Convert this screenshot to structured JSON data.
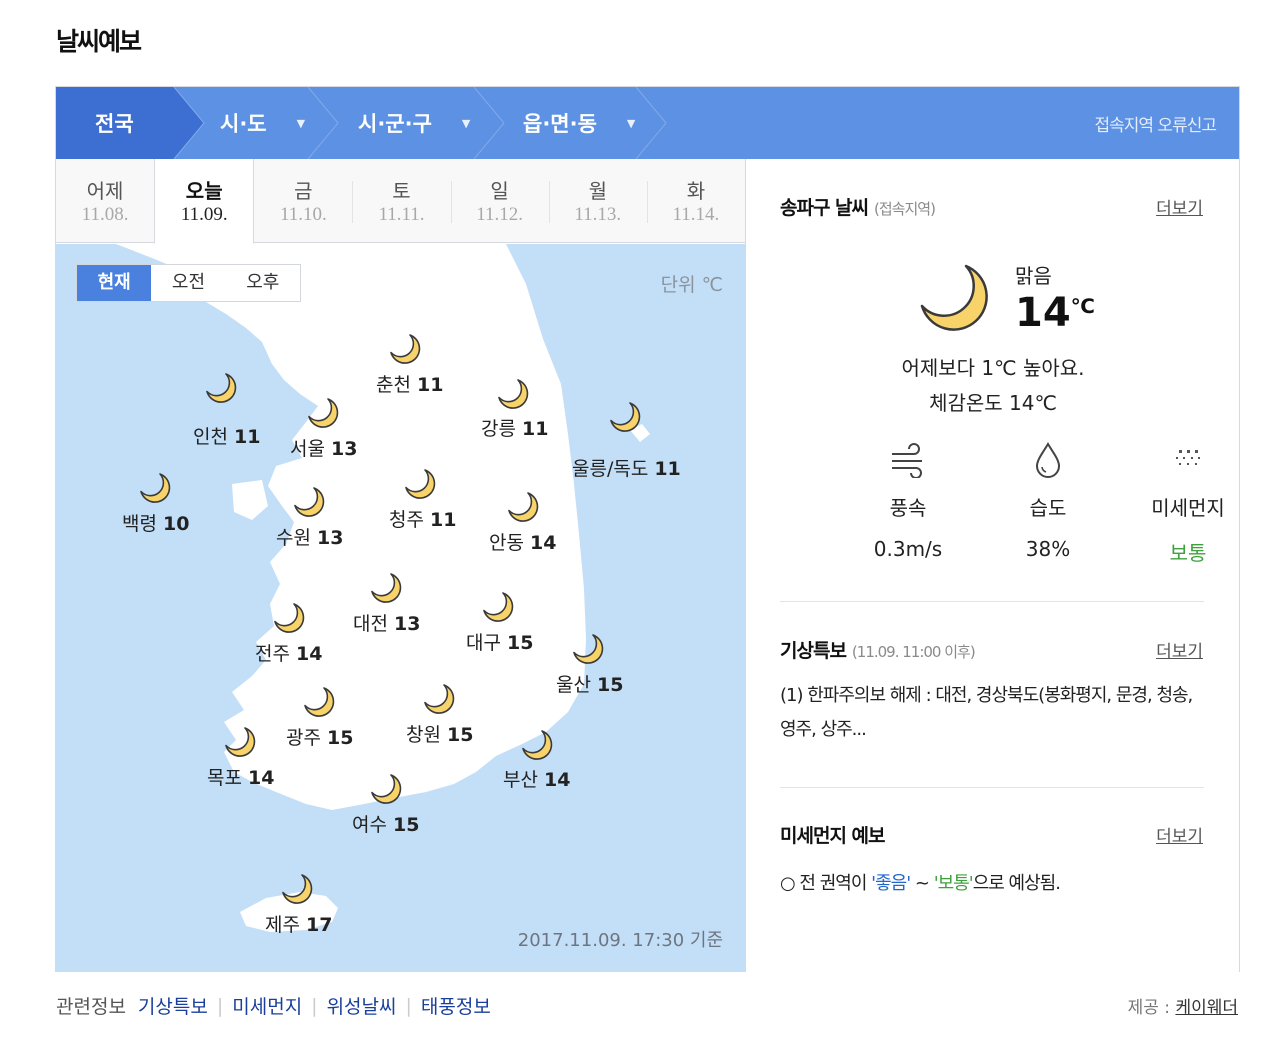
{
  "title": "날씨예보",
  "nav": {
    "tabs": [
      "전국",
      "시·도",
      "시·군·구",
      "읍·면·동"
    ],
    "report": "접속지역 오류신고"
  },
  "days": [
    {
      "name": "어제",
      "date": "11.08."
    },
    {
      "name": "오늘",
      "date": "11.09.",
      "selected": true
    },
    {
      "name": "금",
      "date": "11.10."
    },
    {
      "name": "토",
      "date": "11.11."
    },
    {
      "name": "일",
      "date": "11.12."
    },
    {
      "name": "월",
      "date": "11.13."
    },
    {
      "name": "화",
      "date": "11.14."
    }
  ],
  "map": {
    "time_tabs": [
      "현재",
      "오전",
      "오후"
    ],
    "unit": "단위 ℃",
    "basis": "2017.11.09. 17:30 기준",
    "colors": {
      "sea": "#c3def7",
      "land": "#ffffff",
      "moon": "#f7d36a",
      "moon_stroke": "#3a3a3a"
    },
    "icon": "crescent-moon-icon",
    "cities": [
      {
        "name": "춘천",
        "temp": "11"
      },
      {
        "name": "인천",
        "temp": "11"
      },
      {
        "name": "서울",
        "temp": "13"
      },
      {
        "name": "강릉",
        "temp": "11"
      },
      {
        "name": "울릉/독도",
        "temp": "11"
      },
      {
        "name": "백령",
        "temp": "10"
      },
      {
        "name": "수원",
        "temp": "13"
      },
      {
        "name": "청주",
        "temp": "11"
      },
      {
        "name": "안동",
        "temp": "14"
      },
      {
        "name": "대전",
        "temp": "13"
      },
      {
        "name": "대구",
        "temp": "15"
      },
      {
        "name": "전주",
        "temp": "14"
      },
      {
        "name": "울산",
        "temp": "15"
      },
      {
        "name": "광주",
        "temp": "15"
      },
      {
        "name": "창원",
        "temp": "15"
      },
      {
        "name": "목포",
        "temp": "14"
      },
      {
        "name": "부산",
        "temp": "14"
      },
      {
        "name": "여수",
        "temp": "15"
      },
      {
        "name": "제주",
        "temp": "17"
      }
    ]
  },
  "local": {
    "title": "송파구 날씨",
    "sub": "(접속지역)",
    "more": "더보기",
    "condition": "맑음",
    "temp": "14",
    "temp_unit": "℃",
    "compare": "어제보다 1℃ 높아요.",
    "feels": "체감온도 14℃",
    "stats": [
      {
        "label": "풍속",
        "value": "0.3m/s",
        "icon": "wind-icon"
      },
      {
        "label": "습도",
        "value": "38%",
        "icon": "droplet-icon"
      },
      {
        "label": "미세먼지",
        "value": "보통",
        "icon": "dust-icon",
        "color": "#3fa13e"
      }
    ]
  },
  "alert": {
    "title": "기상특보",
    "sub": "(11.09. 11:00 이후)",
    "more": "더보기",
    "text": "(1) 한파주의보 해제 : 대전, 경상북도(봉화평지, 문경, 청송, 영주, 상주..."
  },
  "dust": {
    "title": "미세먼지 예보",
    "more": "더보기",
    "prefix": "○ 전 권역이 ",
    "good": "'좋음'",
    "mid": " ~ ",
    "normal": "'보통'",
    "suffix": "으로 예상됨."
  },
  "footer": {
    "label": "관련정보",
    "links": [
      "기상특보",
      "미세먼지",
      "위성날씨",
      "태풍정보"
    ],
    "credit_label": "제공 : ",
    "credit_name": "케이웨더"
  }
}
